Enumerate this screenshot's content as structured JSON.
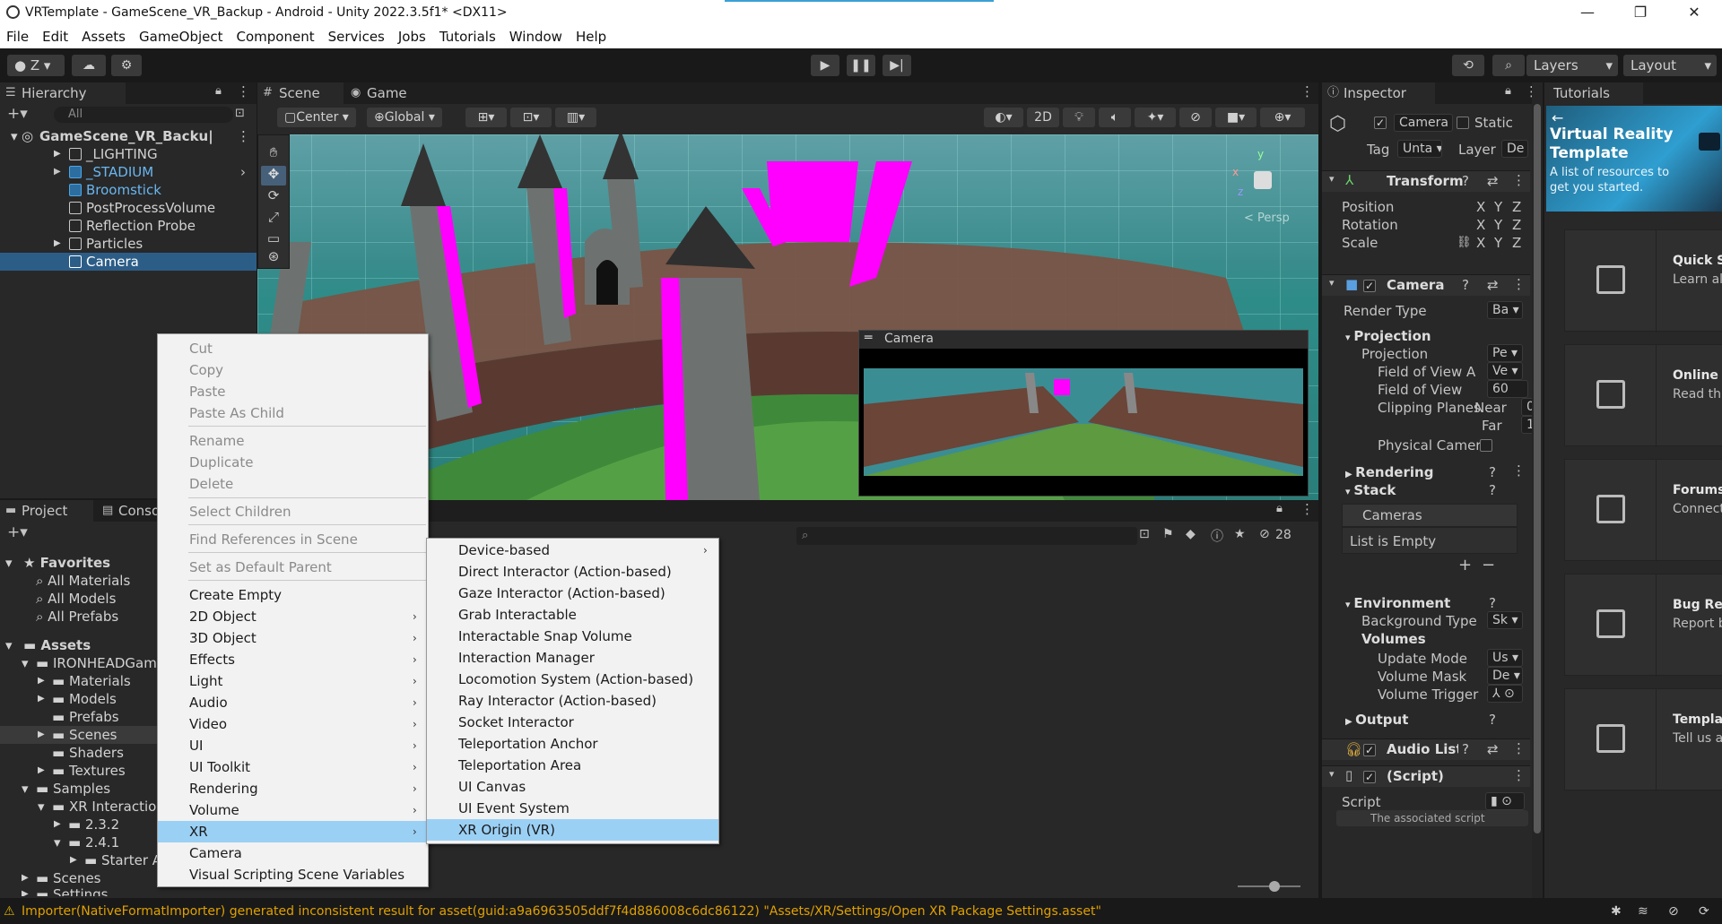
{
  "window": {
    "title": "VRTemplate - GameScene_VR_Backup - Android - Unity 2022.3.5f1* <DX11>",
    "controls": [
      "—",
      "❐",
      "✕"
    ]
  },
  "menubar": [
    "File",
    "Edit",
    "Assets",
    "GameObject",
    "Component",
    "Services",
    "Jobs",
    "Tutorials",
    "Window",
    "Help"
  ],
  "toolbar": {
    "account": "Z ▾",
    "layers": "Layers",
    "layout": "Layout"
  },
  "hierarchy": {
    "tab": "Hierarchy",
    "search_placeholder": "All",
    "scene": "GameScene_VR_Backu|",
    "items": [
      "_LIGHTING",
      "_STADIUM",
      "Broomstick",
      "PostProcessVolume",
      "Reflection Probe",
      "Particles",
      "Camera"
    ]
  },
  "scene_tabs": {
    "scene": "Scene",
    "game": "Game"
  },
  "scene_toolbar": {
    "pivot": "Center",
    "space": "Global",
    "mode2d": "2D"
  },
  "scene_view": {
    "persp": "< Persp",
    "camera_preview_title": "Camera"
  },
  "project": {
    "tabs": {
      "project": "Project",
      "console": "Conso"
    },
    "hidden_count": "28",
    "tree": [
      {
        "label": "Favorites",
        "level": 0,
        "bold": true
      },
      {
        "label": "All Materials",
        "level": 1
      },
      {
        "label": "All Models",
        "level": 1
      },
      {
        "label": "All Prefabs",
        "level": 1
      },
      {
        "label": "Assets",
        "level": 0,
        "bold": true
      },
      {
        "label": "IRONHEADGame",
        "level": 1
      },
      {
        "label": "Materials",
        "level": 2
      },
      {
        "label": "Models",
        "level": 2
      },
      {
        "label": "Prefabs",
        "level": 2
      },
      {
        "label": "Scenes",
        "level": 2
      },
      {
        "label": "Shaders",
        "level": 2
      },
      {
        "label": "Textures",
        "level": 2
      },
      {
        "label": "Samples",
        "level": 1
      },
      {
        "label": "XR Interaction",
        "level": 2
      },
      {
        "label": "2.3.2",
        "level": 3
      },
      {
        "label": "2.4.1",
        "level": 3
      },
      {
        "label": "Starter A",
        "level": 4
      },
      {
        "label": "Scenes",
        "level": 1
      },
      {
        "label": "Settings",
        "level": 1
      }
    ]
  },
  "context_menu": {
    "items": [
      {
        "label": "Cut",
        "disabled": true
      },
      {
        "label": "Copy",
        "disabled": true
      },
      {
        "label": "Paste",
        "disabled": true
      },
      {
        "label": "Paste As Child",
        "disabled": true
      },
      {
        "label": "Rename",
        "disabled": true
      },
      {
        "label": "Duplicate",
        "disabled": true
      },
      {
        "label": "Delete",
        "disabled": true
      },
      {
        "label": "Select Children",
        "disabled": true
      },
      {
        "label": "Find References in Scene",
        "disabled": true
      },
      {
        "label": "Set as Default Parent",
        "disabled": true
      },
      {
        "label": "Create Empty"
      },
      {
        "label": "2D Object",
        "submenu": true
      },
      {
        "label": "3D Object",
        "submenu": true
      },
      {
        "label": "Effects",
        "submenu": true
      },
      {
        "label": "Light",
        "submenu": true
      },
      {
        "label": "Audio",
        "submenu": true
      },
      {
        "label": "Video",
        "submenu": true
      },
      {
        "label": "UI",
        "submenu": true
      },
      {
        "label": "UI Toolkit",
        "submenu": true
      },
      {
        "label": "Rendering",
        "submenu": true
      },
      {
        "label": "Volume",
        "submenu": true
      },
      {
        "label": "XR",
        "submenu": true,
        "highlighted": true
      },
      {
        "label": "Camera"
      },
      {
        "label": "Visual Scripting Scene Variables"
      }
    ]
  },
  "xr_submenu": {
    "items": [
      {
        "label": "Device-based",
        "submenu": true
      },
      {
        "label": "Direct Interactor (Action-based)"
      },
      {
        "label": "Gaze Interactor (Action-based)"
      },
      {
        "label": "Grab Interactable"
      },
      {
        "label": "Interactable Snap Volume"
      },
      {
        "label": "Interaction Manager"
      },
      {
        "label": "Locomotion System (Action-based)"
      },
      {
        "label": "Ray Interactor (Action-based)"
      },
      {
        "label": "Socket Interactor"
      },
      {
        "label": "Teleportation Anchor"
      },
      {
        "label": "Teleportation Area"
      },
      {
        "label": "UI Canvas"
      },
      {
        "label": "UI Event System"
      },
      {
        "label": "XR Origin (VR)",
        "highlighted": true
      }
    ]
  },
  "inspector": {
    "tab": "Inspector",
    "object_name": "Camera",
    "static_label": "Static",
    "tag_label": "Tag",
    "tag_value": "Unta",
    "layer_label": "Layer",
    "layer_value": "De",
    "transform": {
      "title": "Transform",
      "rows": [
        {
          "label": "Position"
        },
        {
          "label": "Rotation"
        },
        {
          "label": "Scale"
        }
      ],
      "axes": [
        "X",
        "Y",
        "Z"
      ]
    },
    "camera": {
      "title": "Camera",
      "render_type_label": "Render Type",
      "render_type_value": "Ba",
      "projection_header": "Projection",
      "projection_label": "Projection",
      "projection_value": "Pe",
      "fov_axis_label": "Field of View A",
      "fov_axis_value": "Ve",
      "fov_label": "Field of View",
      "fov_value": "60",
      "clipping_label": "Clipping Planes",
      "near_label": "Near",
      "near_value": "0",
      "far_label": "Far",
      "far_value": "1",
      "physical_label": "Physical Camer",
      "rendering_header": "Rendering",
      "stack_header": "Stack",
      "cameras_label": "Cameras",
      "list_empty": "List is Empty",
      "environment_header": "Environment",
      "bg_type_label": "Background Type",
      "bg_type_value": "Sk",
      "volumes_label": "Volumes",
      "update_mode_label": "Update Mode",
      "update_mode_value": "Us",
      "volume_mask_label": "Volume Mask",
      "volume_mask_value": "De",
      "volume_trigger_label": "Volume Trigger",
      "output_header": "Output"
    },
    "audio_listener": "Audio Liste",
    "script_component": "(Script)",
    "script_label": "Script",
    "script_hint": "The associated script"
  },
  "tutorials": {
    "tab": "Tutorials",
    "banner_title": "Virtual Reality Template",
    "banner_sub": "A list of resources to get you started.",
    "cards": [
      {
        "title": "Quick S",
        "text": "Learn al features"
      },
      {
        "title": "Online D",
        "text": "Read th docume"
      },
      {
        "title": "Forums",
        "text": "Connect commu"
      },
      {
        "title": "Bug Rep",
        "text": "Report b team"
      },
      {
        "title": "Templa",
        "text": "Tell us a experien"
      }
    ]
  },
  "status": {
    "message": "Importer(NativeFormatImporter) generated inconsistent result for asset(guid:a9a6963505ddf7f4d886008c6dc86122) \"Assets/XR/Settings/Open XR Package Settings.asset\""
  },
  "colors": {
    "accent": "#2c5d87",
    "menu_highlight": "#9bd0f5",
    "warning": "#e0a000",
    "magenta": "#ff00ff"
  }
}
